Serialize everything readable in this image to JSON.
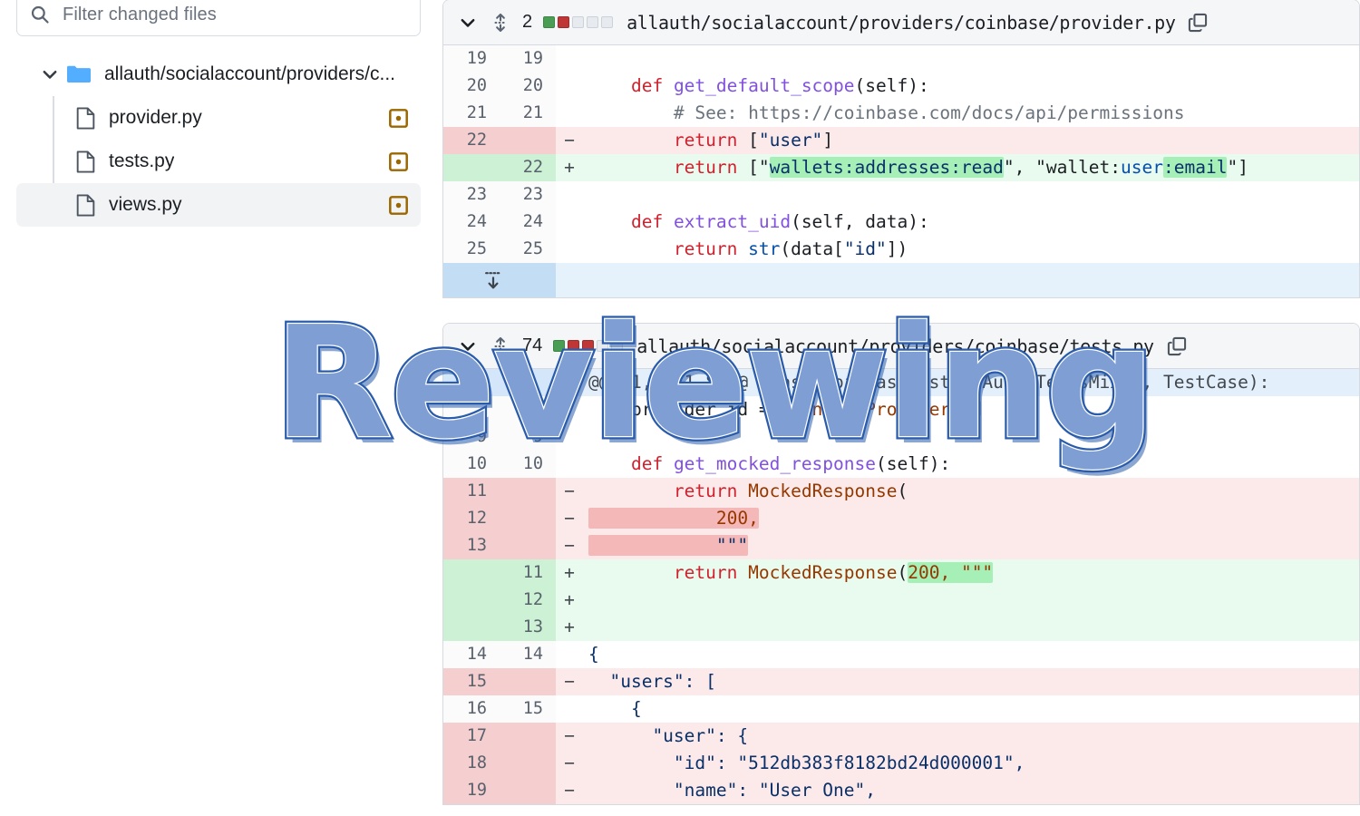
{
  "sidebar": {
    "search": {
      "placeholder": "Filter changed files",
      "value": "",
      "icon": "search-icon"
    },
    "folder": {
      "label": "allauth/socialaccount/providers/c...",
      "expanded": true,
      "icon": "folder-icon",
      "chevron": "chevron-down-icon"
    },
    "files": [
      {
        "label": "provider.py",
        "status": "modified",
        "status_icon": "dot-in-square-icon",
        "selected": false
      },
      {
        "label": "tests.py",
        "status": "modified",
        "status_icon": "dot-in-square-icon",
        "selected": false
      },
      {
        "label": "views.py",
        "status": "modified",
        "status_icon": "dot-in-square-icon",
        "selected": true
      }
    ]
  },
  "overlay": {
    "watermark_text": "Reviewing"
  },
  "colors": {
    "add_bg": "#e9fbee",
    "add_gutter": "#ccf1d4",
    "add_word": "#a6f0b8",
    "del_bg": "#fceaea",
    "del_gutter": "#f5cfcf",
    "del_word": "#f5b8b8",
    "hunk_bg": "#e3f0fc",
    "expander_bg": "#e5f1fb",
    "stat_add": "#4a9e54",
    "stat_del": "#bf3636",
    "stat_none": "#e7eaee",
    "status_modified": "#9a6700",
    "watermark_fill": "#7f9fd4",
    "watermark_stroke": "#2a5cab"
  },
  "diffs": [
    {
      "id": "file-1",
      "chevron": "chevron-down-icon",
      "move_icon": "move-vertical-icon",
      "count": "2",
      "stats": [
        "add",
        "del",
        "none",
        "none",
        "none"
      ],
      "path": "allauth/socialaccount/providers/coinbase/provider.py",
      "copy_icon": "copy-icon",
      "rows": [
        {
          "type": "ctx",
          "old": "19",
          "new": "19",
          "mark": "",
          "code": ""
        },
        {
          "type": "ctx",
          "old": "20",
          "new": "20",
          "mark": "",
          "segs": [
            {
              "t": "    ",
              "c": "pl"
            },
            {
              "t": "def ",
              "c": "k"
            },
            {
              "t": "get_default_scope",
              "c": "fn"
            },
            {
              "t": "(self):",
              "c": "pl"
            }
          ]
        },
        {
          "type": "ctx",
          "old": "21",
          "new": "21",
          "mark": "",
          "segs": [
            {
              "t": "        # See: https://coinbase.com/docs/api/permissions",
              "c": "cm"
            }
          ]
        },
        {
          "type": "del",
          "old": "22",
          "new": "",
          "mark": "−",
          "segs": [
            {
              "t": "        ",
              "c": "pl"
            },
            {
              "t": "return",
              "c": "k"
            },
            {
              "t": " [",
              "c": "pl"
            },
            {
              "t": "\"user\"",
              "c": "st"
            },
            {
              "t": "]",
              "c": "pl"
            }
          ]
        },
        {
          "type": "add",
          "old": "",
          "new": "22",
          "mark": "+",
          "segs": [
            {
              "t": "        ",
              "c": "pl"
            },
            {
              "t": "return",
              "c": "k"
            },
            {
              "t": " [\"",
              "c": "pl"
            },
            {
              "t": "wallets:addresses:read",
              "c": "st wadd"
            },
            {
              "t": "\", \"wallet:",
              "c": "pl"
            },
            {
              "t": "user",
              "c": "num"
            },
            {
              "t": ":email",
              "c": "st wadd"
            },
            {
              "t": "\"]",
              "c": "pl"
            }
          ]
        },
        {
          "type": "ctx",
          "old": "23",
          "new": "23",
          "mark": "",
          "code": ""
        },
        {
          "type": "ctx",
          "old": "24",
          "new": "24",
          "mark": "",
          "segs": [
            {
              "t": "    ",
              "c": "pl"
            },
            {
              "t": "def ",
              "c": "k"
            },
            {
              "t": "extract_uid",
              "c": "fn"
            },
            {
              "t": "(self, data):",
              "c": "pl"
            }
          ]
        },
        {
          "type": "ctx",
          "old": "25",
          "new": "25",
          "mark": "",
          "segs": [
            {
              "t": "        ",
              "c": "pl"
            },
            {
              "t": "return",
              "c": "k"
            },
            {
              "t": " ",
              "c": "pl"
            },
            {
              "t": "str",
              "c": "num"
            },
            {
              "t": "(data[",
              "c": "pl"
            },
            {
              "t": "\"id\"",
              "c": "st"
            },
            {
              "t": "])",
              "c": "pl"
            }
          ]
        },
        {
          "type": "expander",
          "old": "",
          "new": "",
          "mark": "",
          "icon": "expand-down-icon",
          "code": ""
        }
      ]
    },
    {
      "id": "file-2",
      "chevron": "chevron-down-icon",
      "move_icon": "move-vertical-icon",
      "count": "74",
      "stats": [
        "add",
        "del",
        "del",
        "none",
        "none"
      ],
      "path": "allauth/socialaccount/providers/coinbase/tests.py",
      "copy_icon": "copy-icon",
      "rows": [
        {
          "type": "hunk",
          "old": "",
          "new": "",
          "mark": "",
          "code": "@@ -1,4 +1,8 @@ class CoinbaseTests(OAuth2TestsMixin, TestCase):"
        },
        {
          "type": "ctx",
          "old": "",
          "new": "",
          "mark": "",
          "segs": [
            {
              "t": "    provider_id = ",
              "c": "pl"
            },
            {
              "t": "CoinbaseProvider",
              "c": "cls"
            },
            {
              "t": ".id",
              "c": "pl"
            }
          ]
        },
        {
          "type": "ctx",
          "old": "9",
          "new": "9",
          "mark": "",
          "code": ""
        },
        {
          "type": "ctx",
          "old": "10",
          "new": "10",
          "mark": "",
          "segs": [
            {
              "t": "    ",
              "c": "pl"
            },
            {
              "t": "def ",
              "c": "k"
            },
            {
              "t": "get_mocked_response",
              "c": "fn"
            },
            {
              "t": "(self):",
              "c": "pl"
            }
          ]
        },
        {
          "type": "del",
          "old": "11",
          "new": "",
          "mark": "−",
          "segs": [
            {
              "t": "        ",
              "c": "pl"
            },
            {
              "t": "return",
              "c": "k"
            },
            {
              "t": " ",
              "c": "pl"
            },
            {
              "t": "MockedResponse",
              "c": "cls"
            },
            {
              "t": "(",
              "c": "pl"
            }
          ]
        },
        {
          "type": "del",
          "old": "12",
          "new": "",
          "mark": "−",
          "segs": [
            {
              "t": "            200,",
              "c": "cls wdel"
            }
          ]
        },
        {
          "type": "del",
          "old": "13",
          "new": "",
          "mark": "−",
          "segs": [
            {
              "t": "            \"\"\"",
              "c": "st wdel"
            }
          ]
        },
        {
          "type": "add",
          "old": "",
          "new": "11",
          "mark": "+",
          "segs": [
            {
              "t": "        ",
              "c": "pl"
            },
            {
              "t": "return",
              "c": "k"
            },
            {
              "t": " ",
              "c": "pl"
            },
            {
              "t": "MockedResponse",
              "c": "cls"
            },
            {
              "t": "(",
              "c": "pl"
            },
            {
              "t": "200, \"\"\"",
              "c": "cls wadd"
            }
          ]
        },
        {
          "type": "add",
          "old": "",
          "new": "12",
          "mark": "+",
          "code": ""
        },
        {
          "type": "add",
          "old": "",
          "new": "13",
          "mark": "+",
          "code": ""
        },
        {
          "type": "ctx",
          "old": "14",
          "new": "14",
          "mark": "",
          "segs": [
            {
              "t": "{",
              "c": "st"
            }
          ]
        },
        {
          "type": "del",
          "old": "15",
          "new": "",
          "mark": "−",
          "segs": [
            {
              "t": "  \"users\": [",
              "c": "st"
            }
          ]
        },
        {
          "type": "ctx",
          "old": "16",
          "new": "15",
          "mark": "",
          "segs": [
            {
              "t": "    {",
              "c": "st"
            }
          ]
        },
        {
          "type": "del",
          "old": "17",
          "new": "",
          "mark": "−",
          "segs": [
            {
              "t": "      \"user\": {",
              "c": "st"
            }
          ]
        },
        {
          "type": "del",
          "old": "18",
          "new": "",
          "mark": "−",
          "segs": [
            {
              "t": "        \"id\": \"512db383f8182bd24d000001\",",
              "c": "st"
            }
          ]
        },
        {
          "type": "del",
          "old": "19",
          "new": "",
          "mark": "−",
          "segs": [
            {
              "t": "        \"name\": \"User One\",",
              "c": "st"
            }
          ]
        }
      ]
    }
  ]
}
